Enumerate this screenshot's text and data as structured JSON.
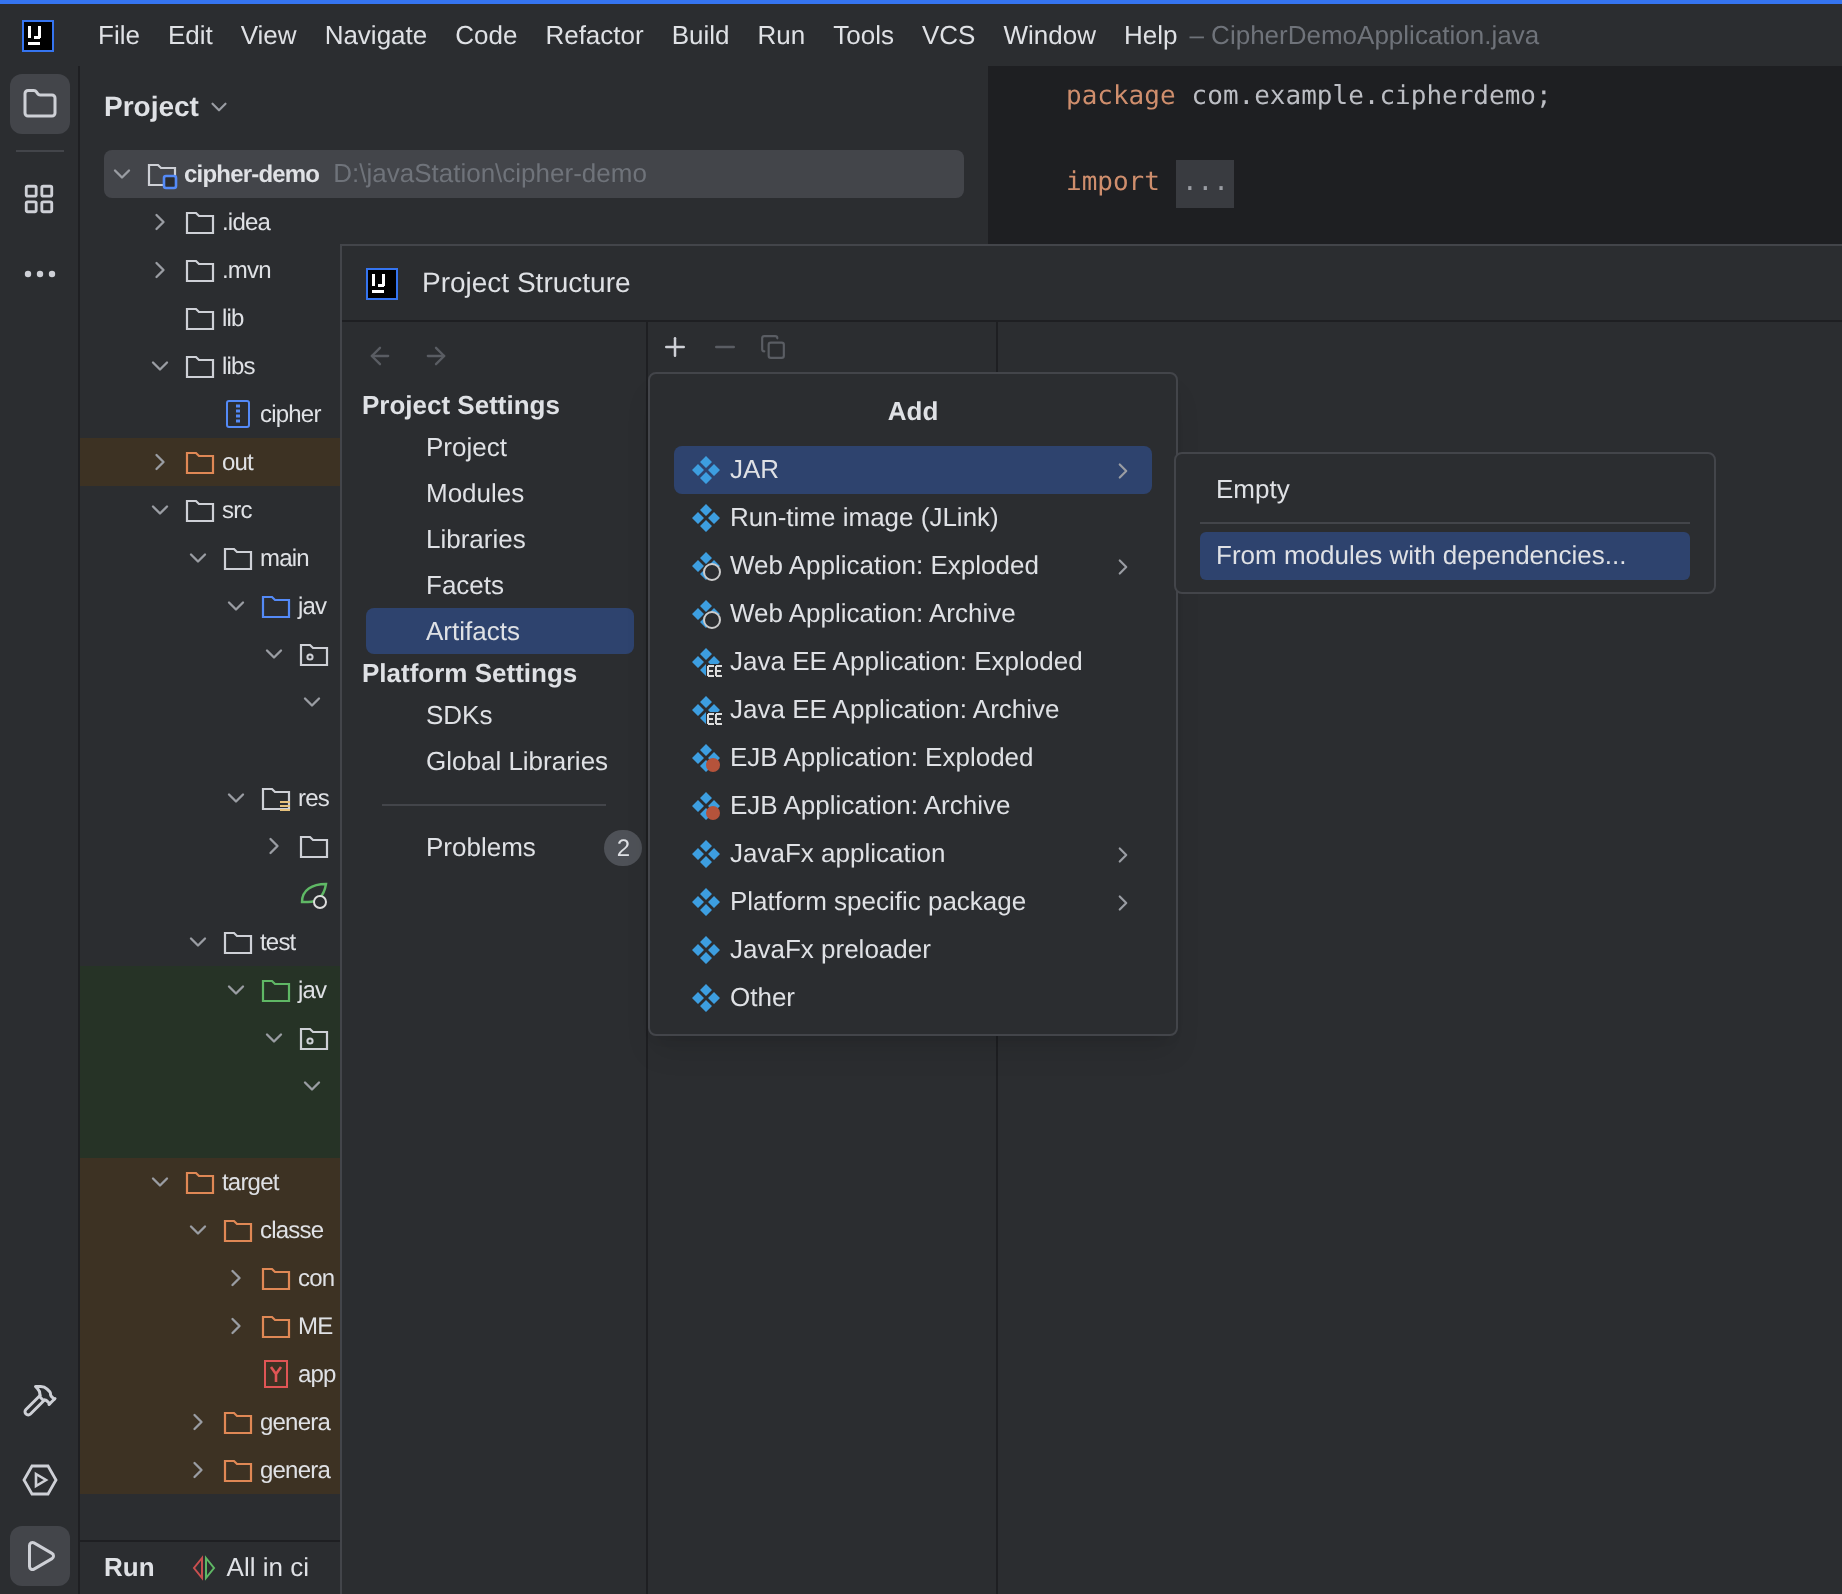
{
  "menu": {
    "items": [
      "File",
      "Edit",
      "View",
      "Navigate",
      "Code",
      "Refactor",
      "Build",
      "Run",
      "Tools",
      "VCS",
      "Window",
      "Help"
    ],
    "file_title": "– CipherDemoApplication.java"
  },
  "project_panel": {
    "title": "Project",
    "tree": [
      {
        "label": "cipher-demo",
        "path": "D:\\javaStation\\cipher-demo",
        "kind": "module",
        "selected": true,
        "expanded": true,
        "children": [
          {
            "label": ".idea",
            "kind": "folder",
            "expanded": false
          },
          {
            "label": ".mvn",
            "kind": "folder",
            "expanded": false
          },
          {
            "label": "lib",
            "kind": "folder"
          },
          {
            "label": "libs",
            "kind": "folder",
            "expanded": true,
            "children": [
              {
                "label": "cipher",
                "kind": "jar"
              }
            ]
          },
          {
            "label": "out",
            "kind": "excluded-folder",
            "expanded": false,
            "color": "#3d3223"
          },
          {
            "label": "src",
            "kind": "folder",
            "expanded": true,
            "children": [
              {
                "label": "main",
                "kind": "folder",
                "expanded": true,
                "children": [
                  {
                    "label": "jav",
                    "kind": "source-folder",
                    "expanded": true,
                    "children": [
                      {
                        "kind": "package",
                        "expanded": true,
                        "children": [
                          {
                            "expanded": true
                          }
                        ]
                      }
                    ]
                  },
                  {
                    "label": "res",
                    "kind": "resources-folder",
                    "expanded": true,
                    "children": [
                      {
                        "kind": "folder",
                        "expanded": false
                      },
                      {
                        "kind": "spring"
                      }
                    ]
                  }
                ]
              },
              {
                "label": "test",
                "kind": "folder",
                "expanded": true,
                "children": [
                  {
                    "label": "jav",
                    "kind": "test-folder",
                    "expanded": true,
                    "color": "#263326",
                    "children": [
                      {
                        "kind": "package",
                        "expanded": true,
                        "children": [
                          {
                            "expanded": true
                          }
                        ]
                      }
                    ]
                  }
                ]
              }
            ]
          },
          {
            "label": "target",
            "kind": "excluded-folder",
            "expanded": true,
            "color": "#3d3223",
            "children": [
              {
                "label": "classe",
                "kind": "excluded-folder",
                "expanded": true,
                "children": [
                  {
                    "label": "con",
                    "kind": "excluded-folder",
                    "expanded": false
                  },
                  {
                    "label": "ME",
                    "kind": "excluded-folder",
                    "expanded": false
                  },
                  {
                    "label": "app",
                    "kind": "yaml"
                  }
                ]
              },
              {
                "label": "genera",
                "kind": "excluded-folder",
                "expanded": false
              },
              {
                "label": "genera",
                "kind": "excluded-folder",
                "expanded": false
              }
            ]
          }
        ]
      }
    ]
  },
  "editor": {
    "lines": [
      {
        "keyword": "package",
        "text": "com.example.cipherdemo;"
      },
      {
        "keyword": "import",
        "folded": "..."
      }
    ]
  },
  "run_bar": {
    "title": "Run",
    "config": "All in ci"
  },
  "dialog": {
    "title": "Project Structure",
    "groups": [
      {
        "title": "Project Settings",
        "items": [
          {
            "label": "Project",
            "selected": false
          },
          {
            "label": "Modules",
            "selected": false
          },
          {
            "label": "Libraries",
            "selected": false
          },
          {
            "label": "Facets",
            "selected": false
          },
          {
            "label": "Artifacts",
            "selected": true
          }
        ]
      },
      {
        "title": "Platform Settings",
        "items": [
          {
            "label": "SDKs",
            "selected": false
          },
          {
            "label": "Global Libraries",
            "selected": false
          }
        ]
      }
    ],
    "problems": {
      "label": "Problems",
      "count": "2"
    },
    "add_popup": {
      "title": "Add",
      "items": [
        {
          "label": "JAR",
          "kind": "artifact",
          "submenu": true,
          "selected": true
        },
        {
          "label": "Run-time image (JLink)",
          "kind": "artifact",
          "submenu": false,
          "selected": false
        },
        {
          "label": "Web Application: Exploded",
          "kind": "web",
          "submenu": true,
          "selected": false
        },
        {
          "label": "Web Application: Archive",
          "kind": "web",
          "submenu": false,
          "selected": false
        },
        {
          "label": "Java EE Application: Exploded",
          "kind": "javaee",
          "submenu": false,
          "selected": false
        },
        {
          "label": "Java EE Application: Archive",
          "kind": "javaee",
          "submenu": false,
          "selected": false
        },
        {
          "label": "EJB Application: Exploded",
          "kind": "ejb",
          "submenu": false,
          "selected": false
        },
        {
          "label": "EJB Application: Archive",
          "kind": "ejb",
          "submenu": false,
          "selected": false
        },
        {
          "label": "JavaFx application",
          "kind": "artifact",
          "submenu": true,
          "selected": false
        },
        {
          "label": "Platform specific package",
          "kind": "artifact",
          "submenu": true,
          "selected": false
        },
        {
          "label": "JavaFx preloader",
          "kind": "artifact",
          "submenu": false,
          "selected": false
        },
        {
          "label": "Other",
          "kind": "artifact",
          "submenu": false,
          "selected": false
        }
      ]
    },
    "submenu": {
      "items": [
        {
          "label": "Empty",
          "selected": false
        },
        {
          "label": "From modules with dependencies...",
          "selected": true
        }
      ]
    }
  }
}
